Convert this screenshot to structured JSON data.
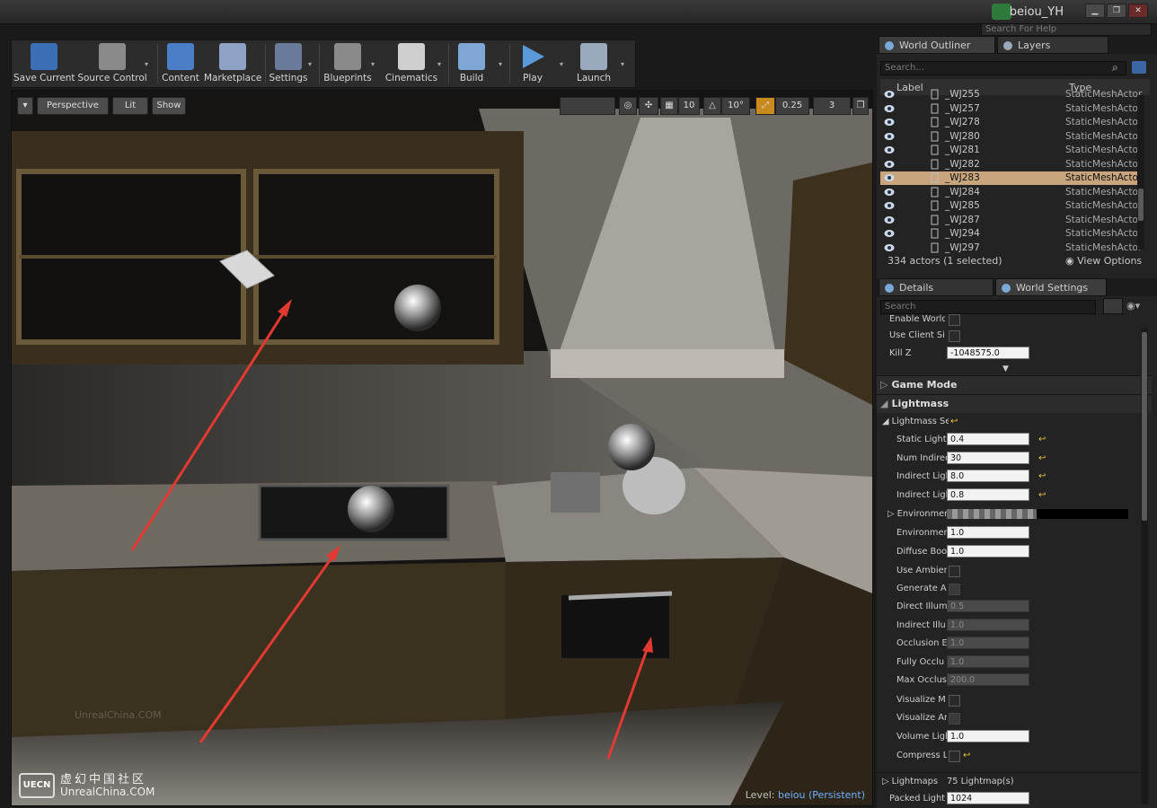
{
  "titlebar": {
    "user": "beiou_YH",
    "help_placeholder": "Search For Help",
    "min": "▁",
    "max": "❐",
    "close": "✕"
  },
  "toolbar": {
    "buttons": [
      {
        "label": "Save Current"
      },
      {
        "label": "Source Control"
      },
      {
        "label": "Content"
      },
      {
        "label": "Marketplace"
      },
      {
        "label": "Settings"
      },
      {
        "label": "Blueprints"
      },
      {
        "label": "Cinematics"
      },
      {
        "label": "Build"
      },
      {
        "label": "Play"
      },
      {
        "label": "Launch"
      }
    ],
    "drop": "▾"
  },
  "viewport": {
    "menu": "▾",
    "perspective": "Perspective",
    "lit": "Lit",
    "show": "Show",
    "grid_snap": "10",
    "rot_snap": "10°",
    "scale_snap": "0.25",
    "cam_speed": "3",
    "level_prefix": "Level:",
    "level_name": "beiou (Persistent)",
    "watermark": "UnrealChina.COM",
    "logo_chinese": "虚幻中国社区",
    "logo_site": "UnrealChina.COM"
  },
  "outliner": {
    "tab_outliner": "World Outliner",
    "tab_layers": "Layers",
    "search_placeholder": "Search...",
    "col_label": "Label",
    "col_type": "Type",
    "rows": [
      {
        "name": "_WJ255",
        "type": "StaticMeshActor"
      },
      {
        "name": "_WJ257",
        "type": "StaticMeshActor"
      },
      {
        "name": "_WJ278",
        "type": "StaticMeshActor"
      },
      {
        "name": "_WJ280",
        "type": "StaticMeshActor"
      },
      {
        "name": "_WJ281",
        "type": "StaticMeshActor"
      },
      {
        "name": "_WJ282",
        "type": "StaticMeshActor"
      },
      {
        "name": "_WJ283",
        "type": "StaticMeshActor"
      },
      {
        "name": "_WJ284",
        "type": "StaticMeshActor"
      },
      {
        "name": "_WJ285",
        "type": "StaticMeshActor"
      },
      {
        "name": "_WJ287",
        "type": "StaticMeshActor"
      },
      {
        "name": "_WJ294",
        "type": "StaticMeshActor"
      },
      {
        "name": "_WJ297",
        "type": "StaticMeshActor"
      }
    ],
    "selected_index": 6,
    "count": "334 actors (1 selected)",
    "view_options": "View Options"
  },
  "details": {
    "tab_details": "Details",
    "tab_world": "World Settings",
    "search_placeholder": "Search",
    "enable_world": "Enable World",
    "use_client": "Use Client Sic",
    "kill_z_label": "Kill Z",
    "kill_z": "-1048575.0",
    "game_mode": "Game Mode",
    "lightmass": "Lightmass",
    "lightmass_settings": "Lightmass Se",
    "rows": [
      {
        "label": "Static Light",
        "value": "0.4",
        "reset": true
      },
      {
        "label": "Num Indirec",
        "value": "30",
        "reset": true
      },
      {
        "label": "Indirect Ligl",
        "value": "8.0",
        "reset": true
      },
      {
        "label": "Indirect Ligl",
        "value": "0.8",
        "reset": true
      }
    ],
    "environment_color": "Environmen",
    "environment_intensity_label": "Environmen",
    "environment_intensity": "1.0",
    "diffuse_boost_label": "Diffuse Boo",
    "diffuse_boost": "1.0",
    "use_ambient": "Use Ambier",
    "generate_ao": "Generate Ar",
    "disabled_rows": [
      {
        "label": "Direct Illum",
        "value": "0.5"
      },
      {
        "label": "Indirect Illu",
        "value": "1.0"
      },
      {
        "label": "Occlusion E",
        "value": "1.0"
      },
      {
        "label": "Fully Occlu",
        "value": "1.0"
      },
      {
        "label": "Max Occlus",
        "value": "200.0"
      }
    ],
    "visualize_m": "Visualize M",
    "visualize_a": "Visualize Ar",
    "volume_label": "Volume Ligl",
    "volume_value": "1.0",
    "compress": "Compress L",
    "lightmaps_label": "Lightmaps",
    "lightmaps_value": "75 Lightmap(s)",
    "packed_label": "Packed Light",
    "packed_value": "1024"
  }
}
